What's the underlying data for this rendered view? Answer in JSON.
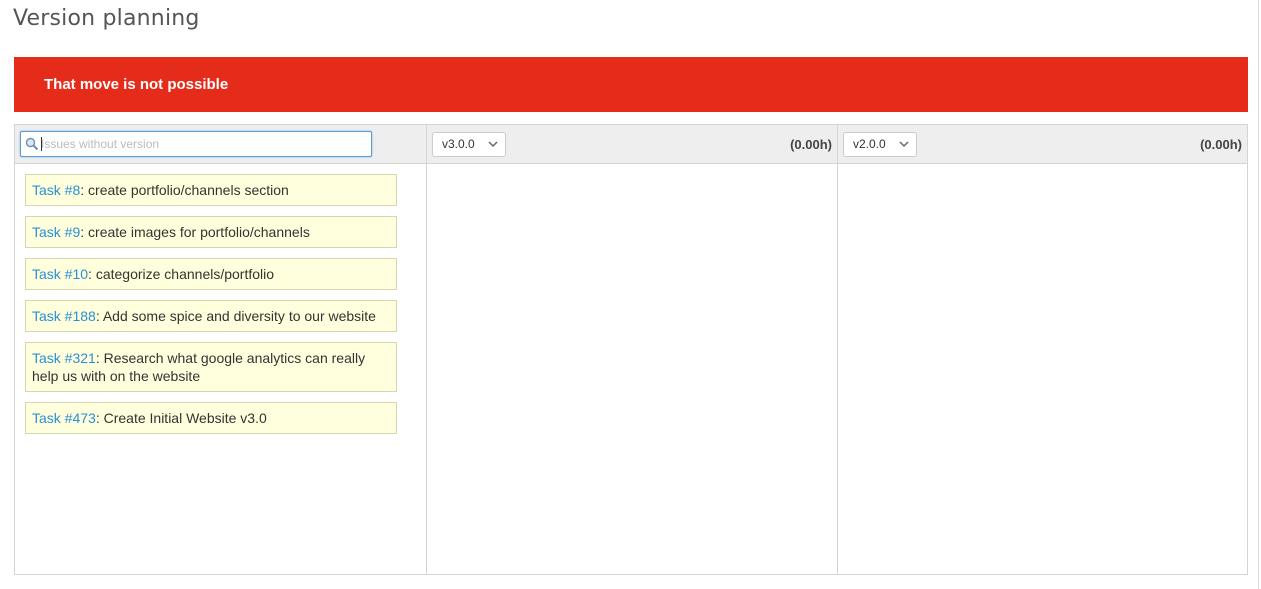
{
  "page": {
    "title": "Version planning"
  },
  "flash": {
    "message": "That move is not possible",
    "color": "#e52b1a"
  },
  "columns": {
    "unversioned": {
      "search_placeholder": "Issues without version",
      "search_value": ""
    },
    "version1": {
      "selected": "v3.0.0",
      "hours": "(0.00h)"
    },
    "version2": {
      "selected": "v2.0.0",
      "hours": "(0.00h)"
    }
  },
  "issues": [
    {
      "link": "Task #8",
      "subject": ": create portfolio/channels section"
    },
    {
      "link": "Task #9",
      "subject": ": create images for portfolio/channels"
    },
    {
      "link": "Task #10",
      "subject": ": categorize channels/portfolio"
    },
    {
      "link": "Task #188",
      "subject": ": Add some spice and diversity to our website"
    },
    {
      "link": "Task #321",
      "subject": ": Research what google analytics can really help us with on the website"
    },
    {
      "link": "Task #473",
      "subject": ": Create Initial Website v3.0"
    }
  ],
  "colors": {
    "link": "#2a8fd3",
    "card_bg": "#ffffdd",
    "header_bg": "#eeeeee"
  },
  "icons": {
    "search": "search-icon",
    "dropdown": "chevron-down-icon"
  }
}
